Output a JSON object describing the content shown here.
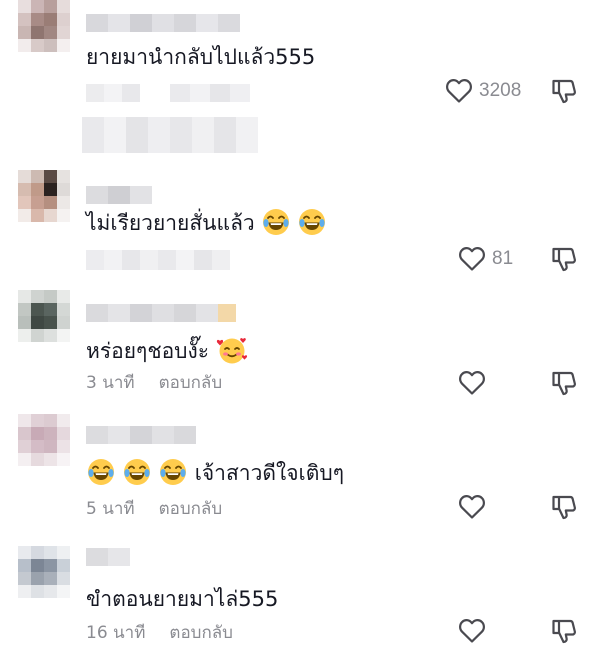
{
  "comments": [
    {
      "text": "ยายมานำกลับไปแล้ว555",
      "emojis": [],
      "time": "",
      "reply": "",
      "likes": "3208"
    },
    {
      "text": "ไม่เรียวยายสั่นแล้ว",
      "emojis": [
        "laughing-emoji",
        "laughing-emoji"
      ],
      "time": "",
      "reply": "",
      "likes": "81"
    },
    {
      "text": "หร่อยๆชอบงั๊ะ",
      "emojis": [
        "smiling-hearts-emoji"
      ],
      "time": "3 นาที",
      "reply": "ตอบกลับ",
      "likes": ""
    },
    {
      "text": "เจ้าสาวดีใจเติบๆ",
      "emojis": [
        "laughing-emoji",
        "laughing-emoji",
        "laughing-emoji"
      ],
      "time": "5 นาที",
      "reply": "ตอบกลับ",
      "likes": ""
    },
    {
      "text": "ขำตอนยายมาไล่555",
      "emojis": [],
      "time": "16 นาที",
      "reply": "ตอบกลับ",
      "likes": ""
    }
  ],
  "colors": {
    "text": "#161823",
    "secondary": "#8a8b91",
    "icon": "#4a4a50"
  },
  "icons": {
    "like": "heart-outline-icon",
    "dislike": "thumbs-down-outline-icon"
  }
}
